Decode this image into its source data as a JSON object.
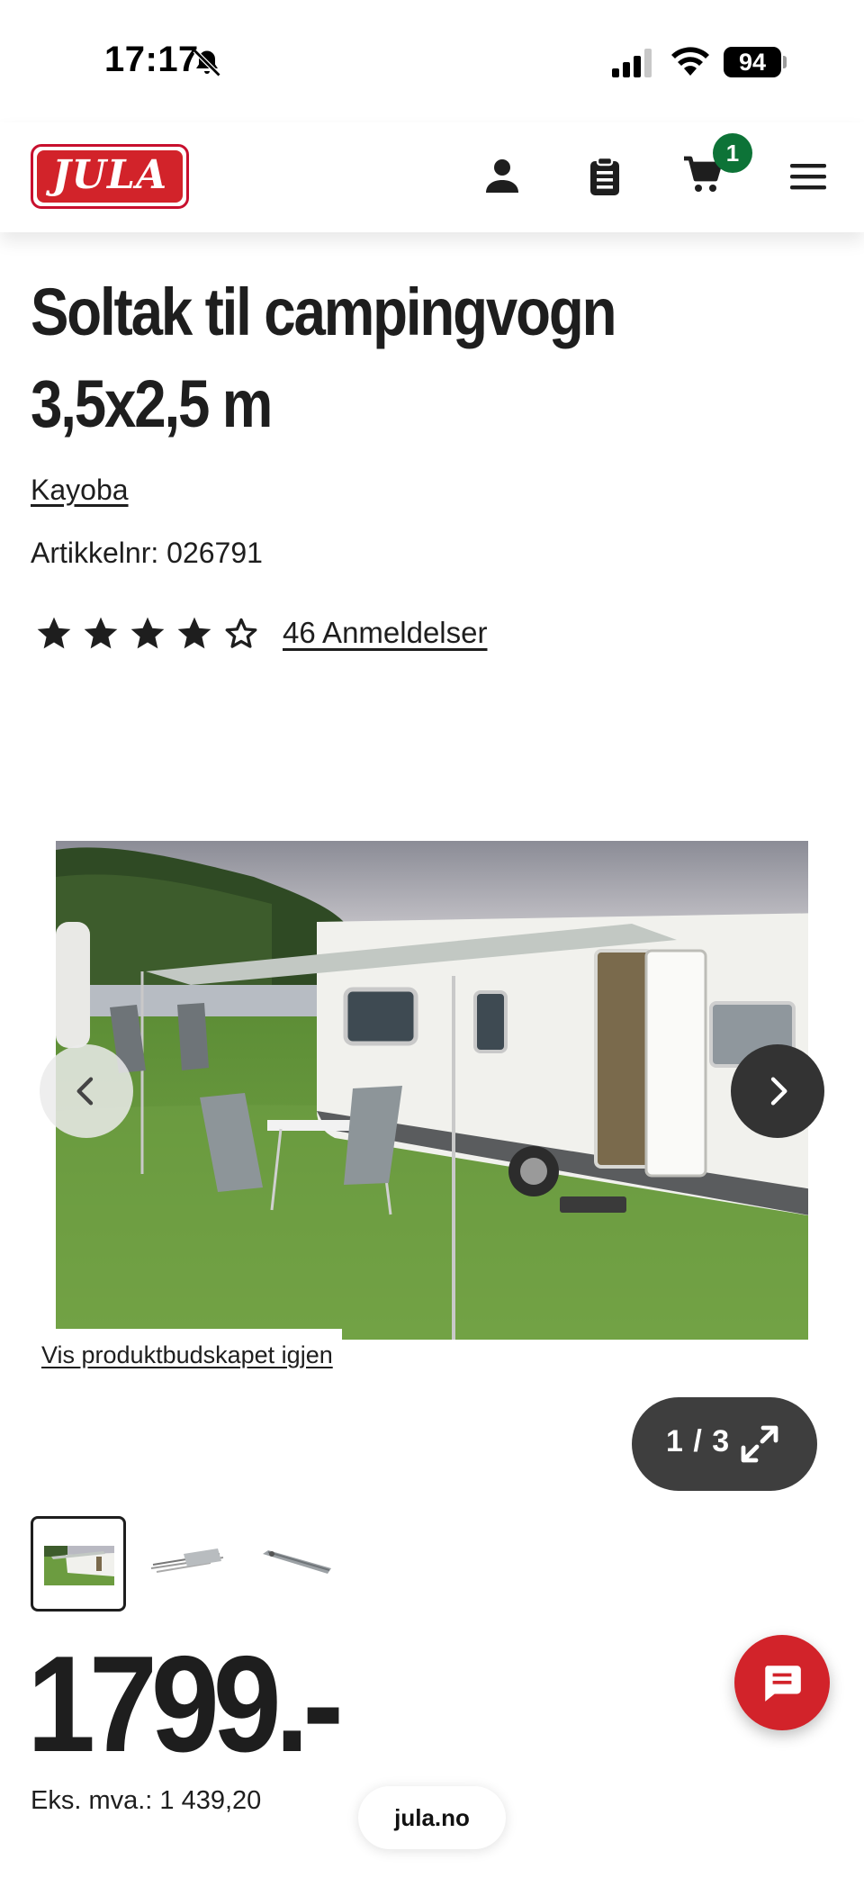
{
  "status_bar": {
    "time": "17:17",
    "battery": "94",
    "icons": [
      "bell-slash-icon",
      "cellular-signal-icon",
      "wifi-icon",
      "battery-icon"
    ]
  },
  "header": {
    "logo_text": "JULA",
    "cart_count": "1",
    "icons": [
      "account-icon",
      "clipboard-list-icon",
      "cart-icon",
      "hamburger-menu-icon"
    ],
    "brand_color": "#d2232a",
    "badge_color": "#0d7337"
  },
  "product": {
    "title_line1": "Soltak til campingvogn",
    "title_line2": "3,5x2,5 m",
    "brand": "Kayoba",
    "article_label": "Artikkelnr:",
    "article_number": "026791",
    "rating": 4,
    "rating_max": 5,
    "reviews_link": "46 Anmeldelser"
  },
  "gallery": {
    "restore_link": "Vis produktbudskapet igjen",
    "counter": "1 / 3",
    "current_image": 1,
    "total_images": 3,
    "icons": [
      "chevron-left-icon",
      "chevron-right-icon",
      "expand-icon"
    ]
  },
  "price": {
    "amount": "1799.-",
    "ex_vat_label": "Eks. mva.:",
    "ex_vat_value": "1 439,20"
  },
  "browser": {
    "url": "jula.no"
  },
  "chat": {
    "icon": "chat-icon",
    "color": "#d2232a"
  }
}
